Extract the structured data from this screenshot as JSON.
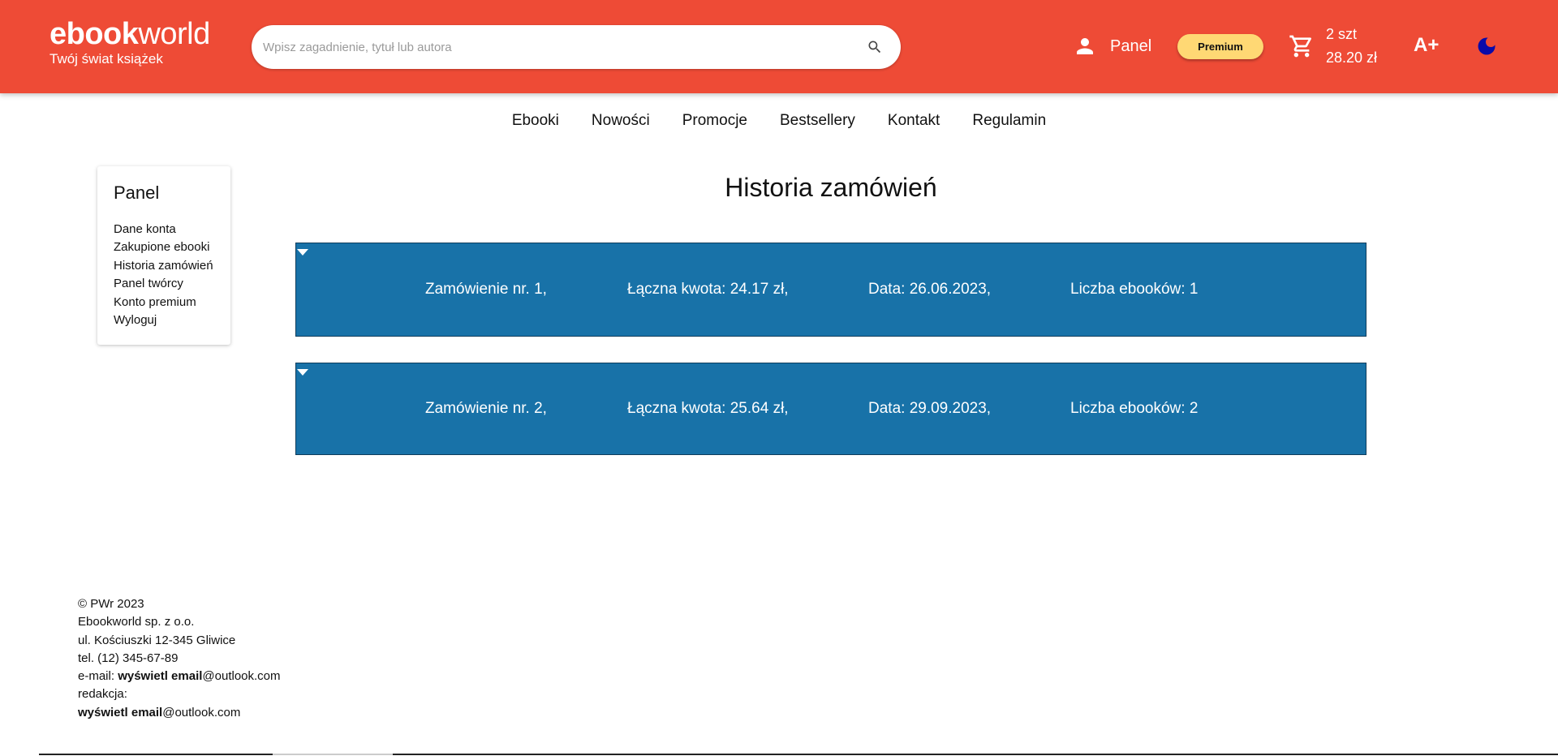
{
  "header": {
    "logo_bold": "ebook",
    "logo_light": "world",
    "tagline": "Twój świat książek",
    "search_placeholder": "Wpisz zagadnienie, tytuł lub autora",
    "panel_label": "Panel",
    "premium_label": "Premium",
    "cart_count": "2 szt",
    "cart_total": "28.20 zł",
    "font_size_label": "A+",
    "brand_color": "#ee4b36",
    "premium_color": "#ffd874",
    "moon_color": "#0a0aa8"
  },
  "nav": {
    "items": [
      "Ebooki",
      "Nowości",
      "Promocje",
      "Bestsellery",
      "Kontakt",
      "Regulamin"
    ]
  },
  "sidebar": {
    "title": "Panel",
    "items": [
      "Dane konta",
      "Zakupione ebooki",
      "Historia zamówień",
      "Panel twórcy",
      "Konto premium",
      "Wyloguj"
    ]
  },
  "main": {
    "title": "Historia zamówień",
    "order_color": "#1872a8",
    "orders": [
      {
        "number": "Zamówienie nr. 1,",
        "total": "Łączna kwota: 24.17 zł,",
        "date": "Data: 26.06.2023,",
        "count": "Liczba ebooków: 1"
      },
      {
        "number": "Zamówienie nr. 2,",
        "total": "Łączna kwota: 25.64 zł,",
        "date": "Data: 29.09.2023,",
        "count": "Liczba ebooków: 2"
      }
    ]
  },
  "footer": {
    "copyright": "© PWr 2023",
    "company": "Ebookworld sp. z o.o.",
    "address": "ul. Kościuszki 12-345 Gliwice",
    "phone": "tel. (12) 345-67-89",
    "email_prefix": "e-mail: ",
    "email_link": "wyświetl email",
    "email_domain": "@outlook.com",
    "editorial_label": "redakcja:",
    "editorial_link": "wyświetl email",
    "editorial_domain": "@outlook.com"
  }
}
